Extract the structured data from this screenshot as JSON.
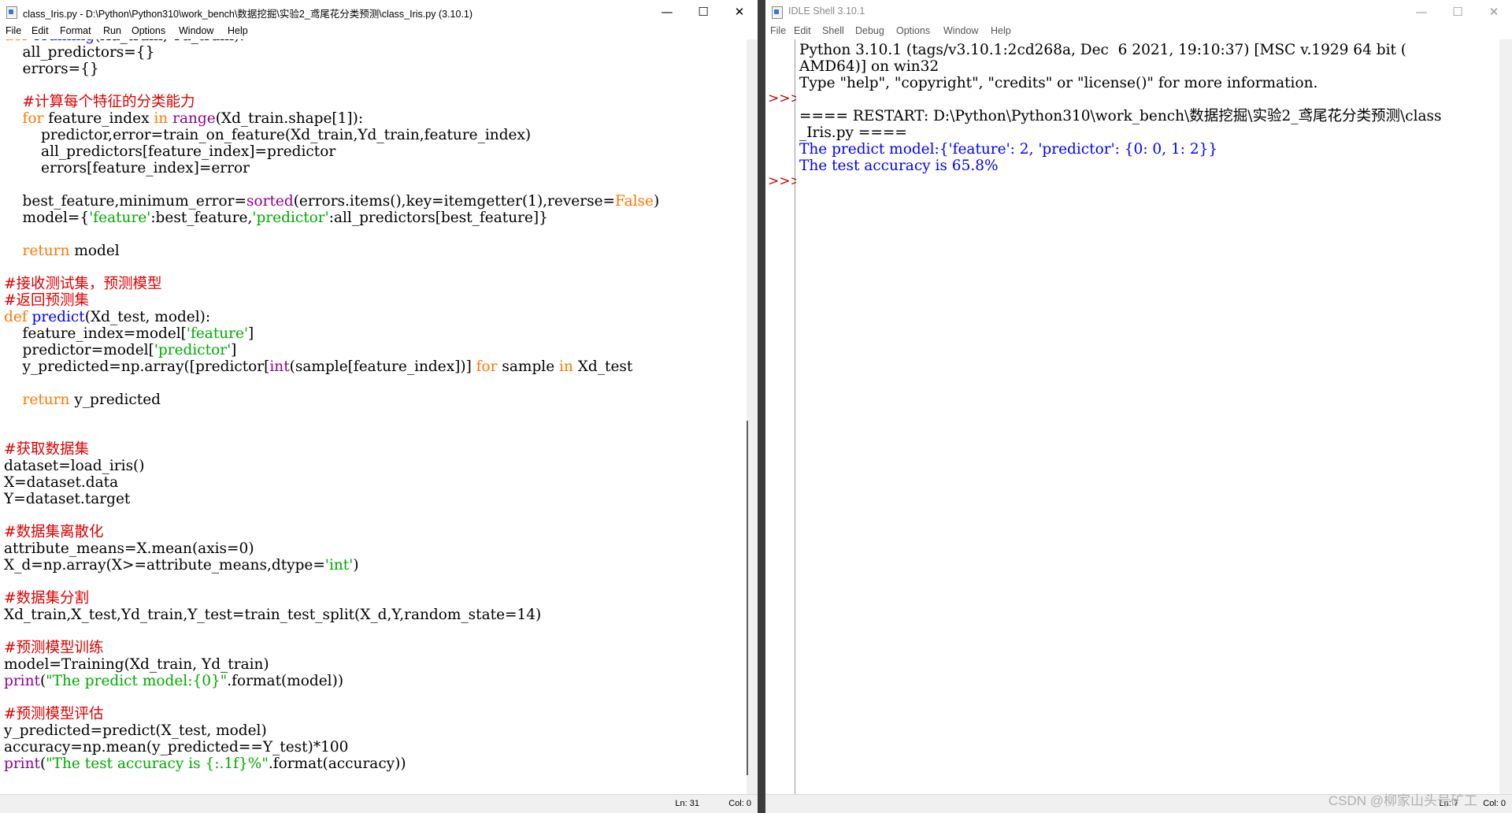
{
  "editor": {
    "title": "class_Iris.py - D:\\Python\\Python310\\work_bench\\数据挖掘\\实验2_鸢尾花分类预测\\class_Iris.py (3.10.1)",
    "menu": [
      "File",
      "Edit",
      "Format",
      "Run",
      "Options",
      "Window",
      "Help"
    ],
    "status_line": "Ln: 31",
    "status_col": "Col: 0",
    "code_lines": [
      [
        [
          "kw",
          "def "
        ],
        [
          "fn",
          "Training"
        ],
        [
          "t",
          "(Xd_train, Yd_train):"
        ]
      ],
      [
        [
          "t",
          "    all_predictors={}"
        ]
      ],
      [
        [
          "t",
          "    errors={}"
        ]
      ],
      [
        [
          "t",
          ""
        ]
      ],
      [
        [
          "cm",
          "    #计算每个特征的分类能力"
        ]
      ],
      [
        [
          "kw",
          "    for "
        ],
        [
          "t",
          "feature_index "
        ],
        [
          "kw",
          "in "
        ],
        [
          "bi",
          "range"
        ],
        [
          "t",
          "(Xd_train.shape[1]):"
        ]
      ],
      [
        [
          "t",
          "        predictor,error=train_on_feature(Xd_train,Yd_train,feature_index)"
        ]
      ],
      [
        [
          "t",
          "        all_predictors[feature_index]=predictor"
        ]
      ],
      [
        [
          "t",
          "        errors[feature_index]=error"
        ]
      ],
      [
        [
          "t",
          ""
        ]
      ],
      [
        [
          "t",
          "    best_feature,minimum_error="
        ],
        [
          "bi",
          "sorted"
        ],
        [
          "t",
          "(errors.items(),key=itemgetter(1),reverse="
        ],
        [
          "kw",
          "False"
        ],
        [
          "t",
          ")"
        ]
      ],
      [
        [
          "t",
          "    model={"
        ],
        [
          "str",
          "'feature'"
        ],
        [
          "t",
          ":best_feature,"
        ],
        [
          "str",
          "'predictor'"
        ],
        [
          "t",
          ":all_predictors[best_feature]}"
        ]
      ],
      [
        [
          "t",
          ""
        ]
      ],
      [
        [
          "kw",
          "    return "
        ],
        [
          "t",
          "model"
        ]
      ],
      [
        [
          "t",
          ""
        ]
      ],
      [
        [
          "cm",
          "#接收测试集，预测模型"
        ]
      ],
      [
        [
          "cm",
          "#返回预测集"
        ]
      ],
      [
        [
          "kw",
          "def "
        ],
        [
          "fn",
          "predict"
        ],
        [
          "t",
          "(Xd_test, model):"
        ]
      ],
      [
        [
          "t",
          "    feature_index=model["
        ],
        [
          "str",
          "'feature'"
        ],
        [
          "t",
          "]"
        ]
      ],
      [
        [
          "t",
          "    predictor=model["
        ],
        [
          "str",
          "'predictor'"
        ],
        [
          "t",
          "]"
        ]
      ],
      [
        [
          "t",
          "    y_predicted=np.array([predictor["
        ],
        [
          "bi",
          "int"
        ],
        [
          "t",
          "(sample[feature_index])] "
        ],
        [
          "kw",
          "for "
        ],
        [
          "t",
          "sample "
        ],
        [
          "kw",
          "in "
        ],
        [
          "t",
          "Xd_test"
        ]
      ],
      [
        [
          "t",
          ""
        ]
      ],
      [
        [
          "kw",
          "    return "
        ],
        [
          "t",
          "y_predicted"
        ]
      ],
      [
        [
          "t",
          ""
        ]
      ],
      [
        [
          "t",
          ""
        ]
      ],
      [
        [
          "cm",
          "#获取数据集"
        ]
      ],
      [
        [
          "t",
          "dataset=load_iris()"
        ]
      ],
      [
        [
          "t",
          "X=dataset.data"
        ]
      ],
      [
        [
          "t",
          "Y=dataset.target"
        ]
      ],
      [
        [
          "t",
          ""
        ]
      ],
      [
        [
          "cm",
          "#数据集离散化"
        ]
      ],
      [
        [
          "t",
          "attribute_means=X.mean(axis=0)"
        ]
      ],
      [
        [
          "t",
          "X_d=np.array(X>=attribute_means,dtype="
        ],
        [
          "str",
          "'int'"
        ],
        [
          "t",
          ")"
        ]
      ],
      [
        [
          "t",
          ""
        ]
      ],
      [
        [
          "cm",
          "#数据集分割"
        ]
      ],
      [
        [
          "t",
          "Xd_train,X_test,Yd_train,Y_test=train_test_split(X_d,Y,random_state=14)"
        ]
      ],
      [
        [
          "t",
          ""
        ]
      ],
      [
        [
          "cm",
          "#预测模型训练"
        ]
      ],
      [
        [
          "t",
          "model=Training(Xd_train, Yd_train)"
        ]
      ],
      [
        [
          "bi",
          "print"
        ],
        [
          "t",
          "("
        ],
        [
          "str",
          "\"The predict model:{0}\""
        ],
        [
          "t",
          ".format(model))"
        ]
      ],
      [
        [
          "t",
          ""
        ]
      ],
      [
        [
          "cm",
          "#预测模型评估"
        ]
      ],
      [
        [
          "t",
          "y_predicted=predict(X_test, model)"
        ]
      ],
      [
        [
          "t",
          "accuracy=np.mean(y_predicted==Y_test)*100"
        ]
      ],
      [
        [
          "bi",
          "print"
        ],
        [
          "t",
          "("
        ],
        [
          "str",
          "\"The test accuracy is {:.1f}%\""
        ],
        [
          "t",
          ".format(accuracy))"
        ]
      ]
    ]
  },
  "shell": {
    "title": "IDLE Shell 3.10.1",
    "menu": [
      "File",
      "Edit",
      "Shell",
      "Debug",
      "Options",
      "Window",
      "Help"
    ],
    "prompt": ">>>",
    "status_line": "Ln: 7",
    "status_col": "Col: 0",
    "lines": [
      [
        [
          "t",
          "Python 3.10.1 (tags/v3.10.1:2cd268a, Dec  6 2021, 19:10:37) [MSC v.1929 64 bit ("
        ]
      ],
      [
        [
          "t",
          "AMD64)] on win32"
        ]
      ],
      [
        [
          "t",
          "Type \"help\", \"copyright\", \"credits\" or \"license()\" for more information."
        ]
      ],
      [
        [
          "t",
          ""
        ]
      ],
      [
        [
          "t",
          "==== RESTART: D:\\Python\\Python310\\work_bench\\数据挖掘\\实验2_鸢尾花分类预测\\class"
        ]
      ],
      [
        [
          "t",
          "_Iris.py ===="
        ]
      ],
      [
        [
          "out",
          "The predict model:{'feature': 2, 'predictor': {0: 0, 1: 2}}"
        ]
      ],
      [
        [
          "out",
          "The test accuracy is 65.8%"
        ]
      ]
    ]
  },
  "watermark": "CSDN @柳家山头号矿工"
}
